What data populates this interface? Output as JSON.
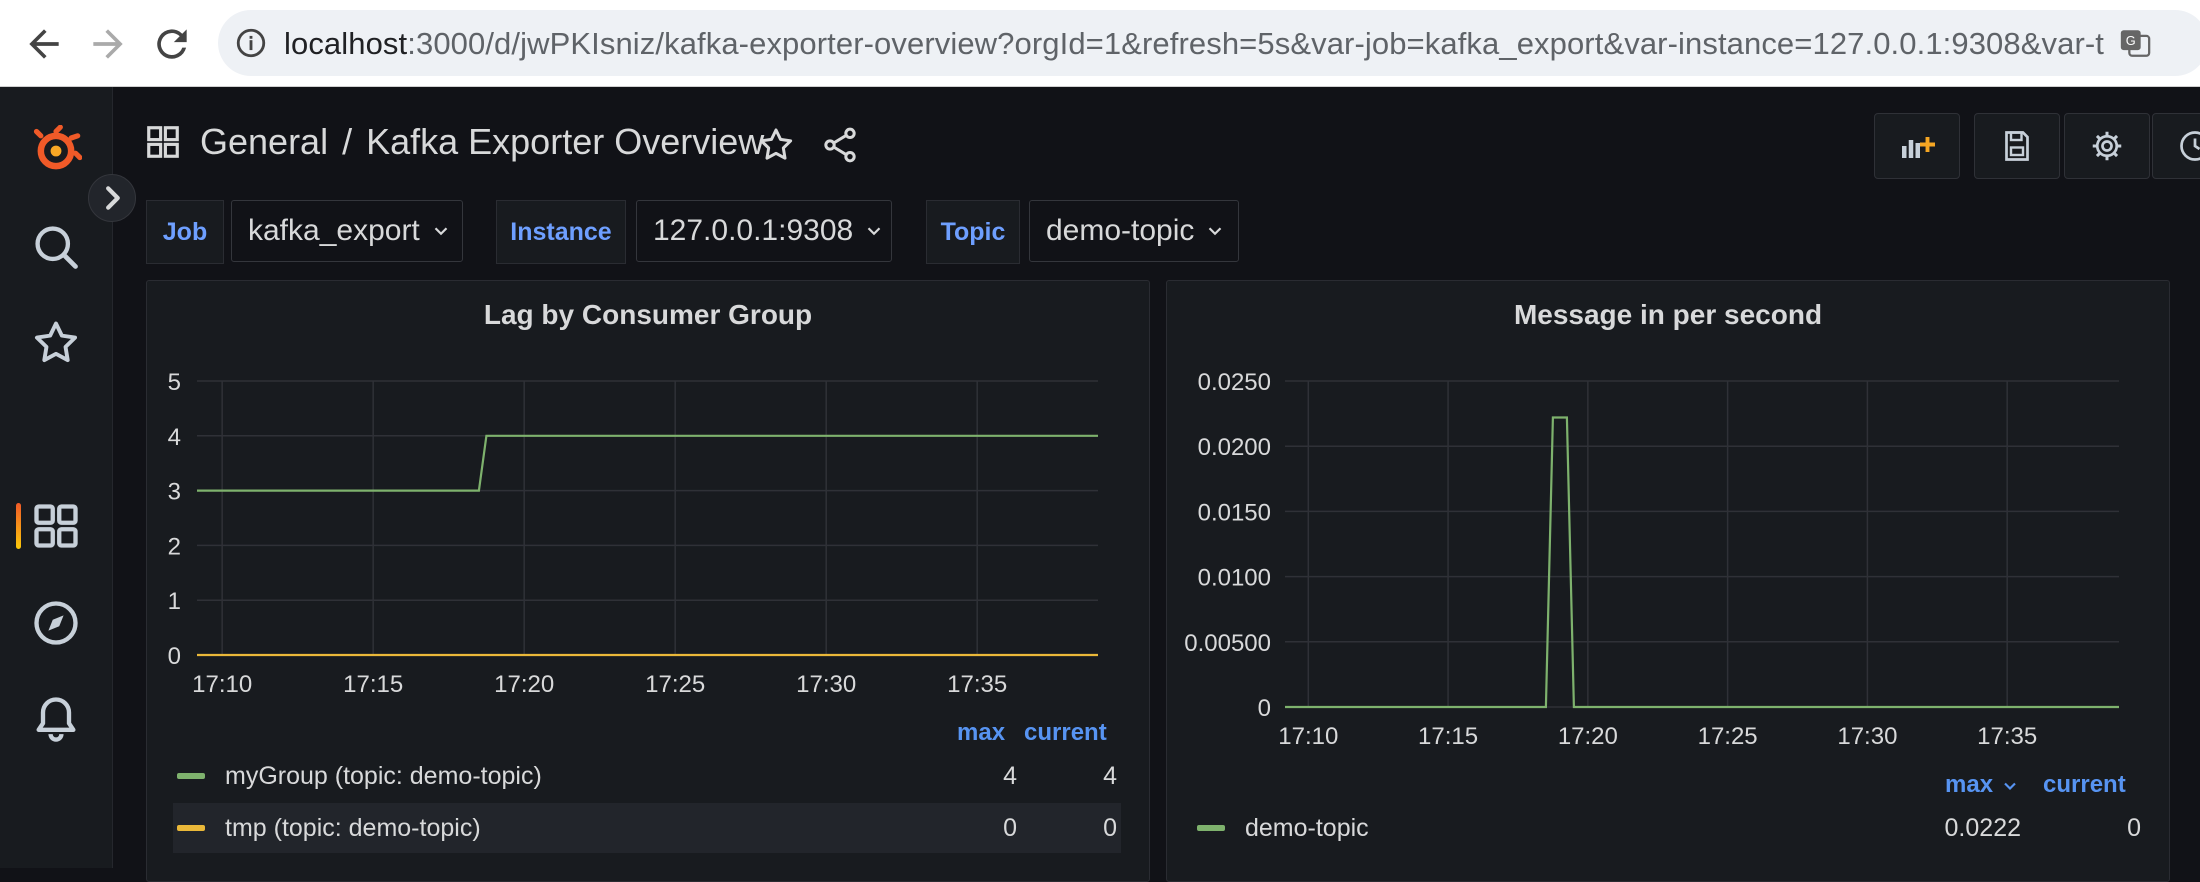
{
  "browser": {
    "url_host": "localhost",
    "url_rest": ":3000/d/jwPKIsniz/kafka-exporter-overview?orgId=1&refresh=5s&var-job=kafka_export&var-instance=127.0.0.1:9308&var-to..."
  },
  "breadcrumb": {
    "folder": "General",
    "separator": "/",
    "dashboard": "Kafka Exporter Overview"
  },
  "variables": [
    {
      "label": "Job",
      "value": "kafka_export"
    },
    {
      "label": "Instance",
      "value": "127.0.0.1:9308"
    },
    {
      "label": "Topic",
      "value": "demo-topic"
    }
  ],
  "panels": {
    "lag": {
      "title": "Lag by Consumer Group",
      "legend_headers": {
        "max": "max",
        "current": "current"
      },
      "legend": [
        {
          "name": "myGroup (topic: demo-topic)",
          "max": "4",
          "current": "4",
          "color": "#7eb26d"
        },
        {
          "name": "tmp (topic: demo-topic)",
          "max": "0",
          "current": "0",
          "color": "#eab839"
        }
      ]
    },
    "msgin": {
      "title": "Message in per second",
      "legend_headers": {
        "max": "max",
        "current": "current"
      },
      "legend": [
        {
          "name": "demo-topic",
          "max": "0.0222",
          "current": "0",
          "color": "#7eb26d"
        }
      ]
    }
  },
  "chart_data": [
    {
      "type": "line",
      "title": "Lag by Consumer Group",
      "x_ticks": [
        "17:10",
        "17:15",
        "17:20",
        "17:25",
        "17:30",
        "17:35"
      ],
      "y_ticks": [
        "0",
        "1",
        "2",
        "3",
        "4",
        "5"
      ],
      "ylim": [
        0,
        5
      ],
      "xlim": [
        "17:09:10",
        "17:39:00"
      ],
      "grid": true,
      "series": [
        {
          "name": "myGroup (topic: demo-topic)",
          "color": "#7eb26d",
          "points": [
            [
              "17:09:10",
              3
            ],
            [
              "17:18:30",
              3
            ],
            [
              "17:18:45",
              4
            ],
            [
              "17:39:00",
              4
            ]
          ]
        },
        {
          "name": "tmp (topic: demo-topic)",
          "color": "#eab839",
          "points": [
            [
              "17:09:10",
              0
            ],
            [
              "17:39:00",
              0
            ]
          ]
        }
      ]
    },
    {
      "type": "line",
      "title": "Message in per second",
      "x_ticks": [
        "17:10",
        "17:15",
        "17:20",
        "17:25",
        "17:30",
        "17:35"
      ],
      "y_ticks": [
        "0",
        "0.00500",
        "0.0100",
        "0.0150",
        "0.0200",
        "0.0250"
      ],
      "ylim": [
        0,
        0.025
      ],
      "xlim": [
        "17:09:10",
        "17:39:00"
      ],
      "grid": true,
      "series": [
        {
          "name": "demo-topic",
          "color": "#7eb26d",
          "points": [
            [
              "17:09:10",
              0
            ],
            [
              "17:18:30",
              0
            ],
            [
              "17:18:45",
              0.0222
            ],
            [
              "17:19:15",
              0.0222
            ],
            [
              "17:19:30",
              0
            ],
            [
              "17:39:00",
              0
            ]
          ]
        }
      ]
    }
  ]
}
